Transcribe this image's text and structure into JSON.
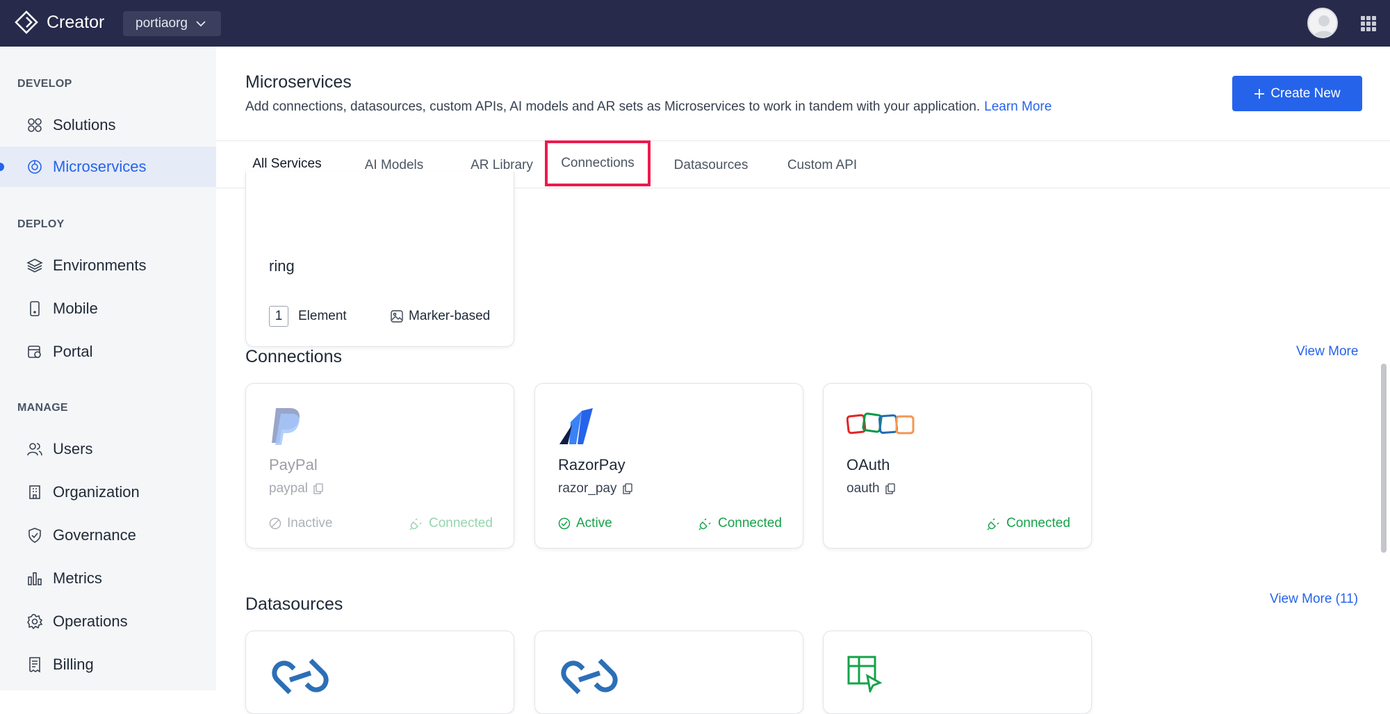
{
  "app": {
    "brand": "Creator",
    "org": "portiaorg"
  },
  "sidebar": {
    "sections": {
      "develop": "DEVELOP",
      "deploy": "DEPLOY",
      "manage": "MANAGE"
    },
    "items": [
      {
        "label": "Solutions",
        "icon": "grid-icon"
      },
      {
        "label": "Microservices",
        "icon": "microservices-icon"
      },
      {
        "label": "Environments",
        "icon": "layers-icon"
      },
      {
        "label": "Mobile",
        "icon": "mobile-icon"
      },
      {
        "label": "Portal",
        "icon": "portal-icon"
      },
      {
        "label": "Users",
        "icon": "users-icon"
      },
      {
        "label": "Organization",
        "icon": "building-icon"
      },
      {
        "label": "Governance",
        "icon": "shield-icon"
      },
      {
        "label": "Metrics",
        "icon": "bar-chart-icon"
      },
      {
        "label": "Operations",
        "icon": "gear-icon"
      },
      {
        "label": "Billing",
        "icon": "receipt-icon"
      }
    ]
  },
  "header": {
    "title": "Microservices",
    "description": "Add connections, datasources, custom APIs, AI models and AR sets as Microservices to work in tandem with your application.",
    "learn_more": "Learn More",
    "create_button": "Create New"
  },
  "tabs": [
    "All Services",
    "AI Models",
    "AR Library",
    "Connections",
    "Datasources",
    "Custom API"
  ],
  "ar_card": {
    "name": "ring",
    "count": "1",
    "count_label": "Element",
    "type": "Marker-based"
  },
  "connections": {
    "heading": "Connections",
    "view_more": "View More",
    "cards": [
      {
        "name": "PayPal",
        "id": "paypal",
        "status": "Inactive",
        "conn": "Connected"
      },
      {
        "name": "RazorPay",
        "id": "razor_pay",
        "status": "Active",
        "conn": "Connected"
      },
      {
        "name": "OAuth",
        "id": "oauth",
        "status": "",
        "conn": "Connected"
      }
    ]
  },
  "datasources": {
    "heading": "Datasources",
    "view_more": "View More (11)"
  },
  "colors": {
    "accent": "#2563eb",
    "topbar": "#272a4a",
    "success": "#16a34a",
    "highlight": "#ec1a4d"
  }
}
